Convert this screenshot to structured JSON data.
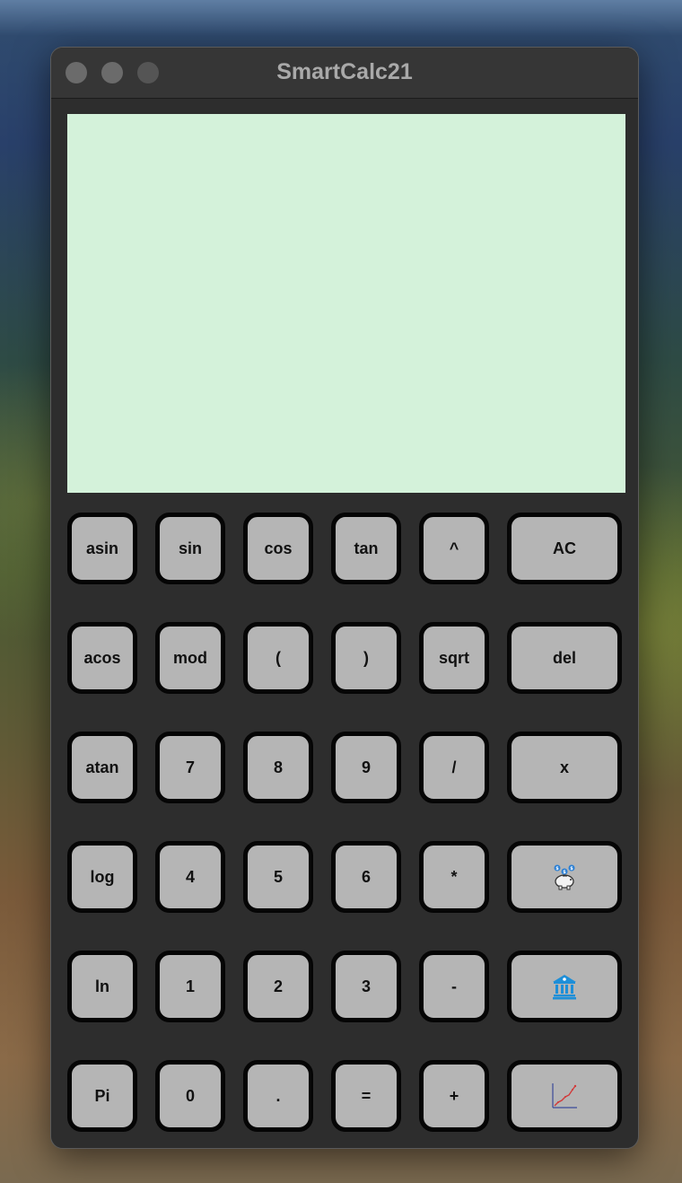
{
  "window": {
    "title": "SmartCalc21"
  },
  "display": {
    "value": ""
  },
  "keypad": {
    "rows": [
      [
        "asin",
        "sin",
        "cos",
        "tan",
        "^",
        "AC"
      ],
      [
        "acos",
        "mod",
        "(",
        ")",
        "sqrt",
        "del"
      ],
      [
        "atan",
        "7",
        "8",
        "9",
        "/",
        "x"
      ],
      [
        "log",
        "4",
        "5",
        "6",
        "*",
        "deposit-calculator-icon"
      ],
      [
        "ln",
        "1",
        "2",
        "3",
        "-",
        "credit-calculator-icon"
      ],
      [
        "Pi",
        "0",
        ".",
        "=",
        "+",
        "graph-icon"
      ]
    ]
  },
  "colors": {
    "display_bg": "#d4f2da",
    "button_bg": "#b5b5b5",
    "window_bg": "#2d2d2d"
  }
}
